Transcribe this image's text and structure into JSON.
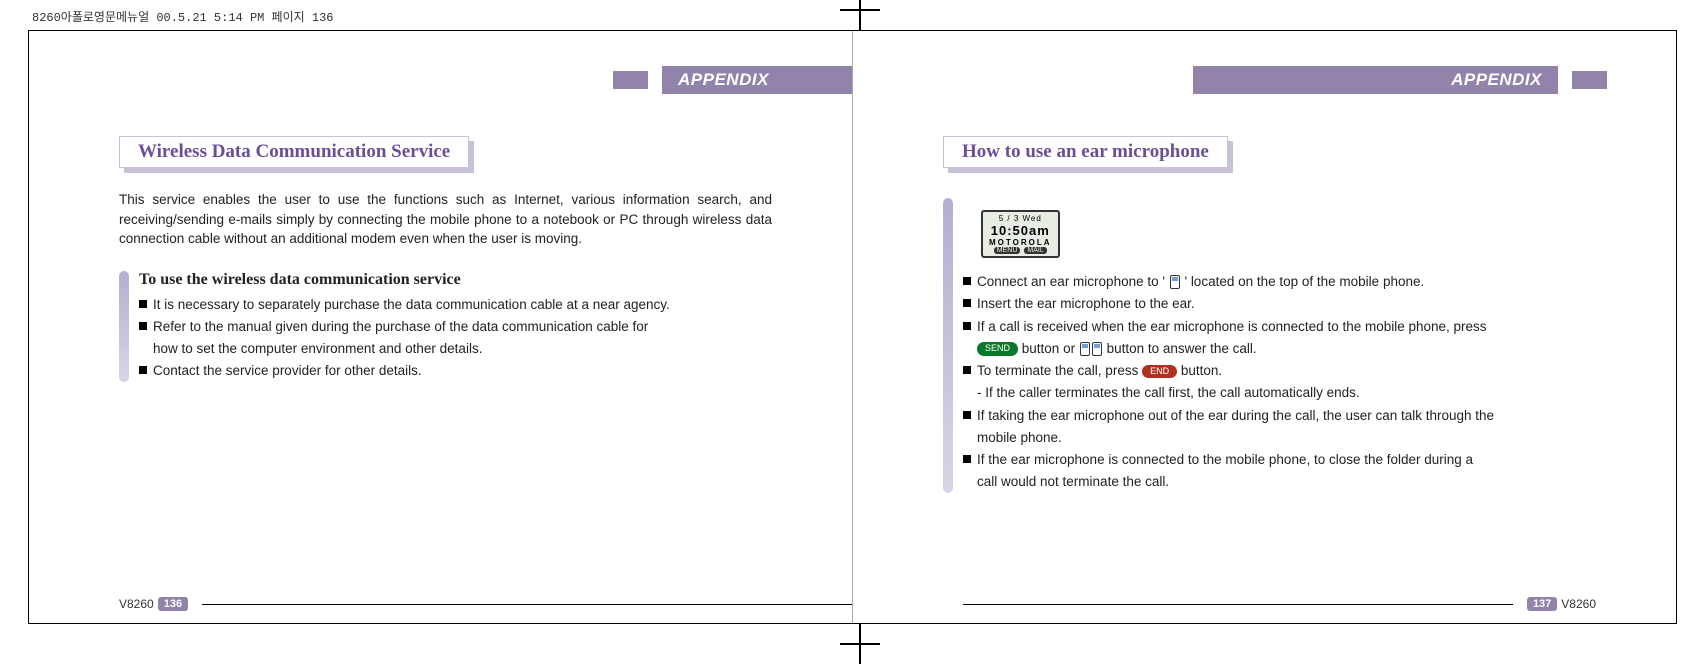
{
  "meta": {
    "header_print_info": "8260아폴로영문메뉴얼   00.5.21 5:14 PM 페이지 136"
  },
  "left_page": {
    "appendix": "APPENDIX",
    "section_title": "Wireless Data Communication Service",
    "intro": "This service enables the user to use the functions such as  Internet, various information search, and receiving/sending e-mails simply by connecting the mobile phone to a notebook or PC through wireless data connection cable  without an additional modem even when the user is moving.",
    "sub_title": "To use the wireless data communication service",
    "bullets": {
      "b1": "It is necessary to separately purchase the data communication cable at a near agency.",
      "b2": "Refer to the manual  given during the purchase  of the data communication cable  for",
      "b2c": "how to set the computer environment and other details.",
      "b3": "Contact the service provider for other details."
    },
    "footer": {
      "model": "V8260",
      "page": "136"
    }
  },
  "right_page": {
    "appendix": "APPENDIX",
    "section_title": "How to use an ear microphone",
    "screen": {
      "line1": "5 / 3  Wed",
      "line2": "10:50am",
      "line3": "MOTOROLA",
      "menu": "MENU",
      "mail": "MAIL"
    },
    "bullets": {
      "b1a": "Connect an ear microphone to  '",
      "b1b": "' located on the top of the mobile phone.",
      "b2": "Insert the ear microphone to the ear.",
      "b3": "If a call is received when the ear microphone is connected to the mobile phone,  press",
      "b3c_a": " button or ",
      "b3c_b": " button to answer the call.",
      "b4a": "To terminate the call, press ",
      "b4b": "  button.",
      "b4c": "- If the caller terminates the call first, the call automatically ends.",
      "b5": "If taking the ear microphone out of the ear during the call, the user can talk through the",
      "b5c": "mobile phone.",
      "b6": "If the ear microphone is  connected to the mobile phone, to  close the folder during a",
      "b6c": "call would not terminate the call."
    },
    "buttons": {
      "send": "SEND",
      "end": "END"
    },
    "footer": {
      "model": "V8260",
      "page": "137"
    }
  }
}
